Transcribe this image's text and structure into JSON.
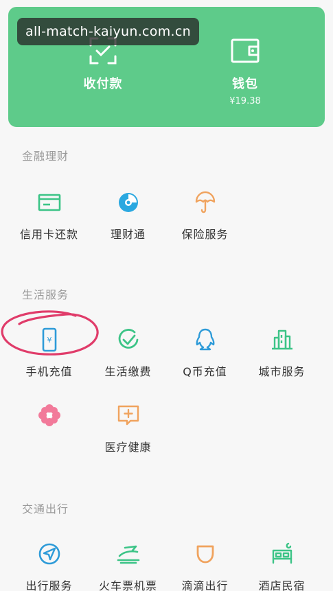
{
  "watermark": {
    "text": "all-match-kaiyun.com.cn"
  },
  "wallet_card": {
    "pay": {
      "label": "收付款",
      "icon": "qr-scan-icon"
    },
    "wallet": {
      "label": "钱包",
      "balance": "¥19.38",
      "icon": "wallet-icon"
    }
  },
  "sections": {
    "finance": {
      "title": "金融理财",
      "items": [
        {
          "label": "信用卡还款",
          "icon": "credit-card-icon",
          "color": "#3cc487"
        },
        {
          "label": "理财通",
          "icon": "wealth-icon",
          "color": "#2aa8e0"
        },
        {
          "label": "保险服务",
          "icon": "umbrella-icon",
          "color": "#f0a35e"
        }
      ]
    },
    "life": {
      "title": "生活服务",
      "items": [
        {
          "label": "手机充值",
          "icon": "phone-yuan-icon",
          "color": "#2e9bd8"
        },
        {
          "label": "生活缴费",
          "icon": "checkmark-circle-icon",
          "color": "#3cc487"
        },
        {
          "label": "Q币充值",
          "icon": "qq-penguin-icon",
          "color": "#2e9bd8"
        },
        {
          "label": "城市服务",
          "icon": "city-buildings-icon",
          "color": "#3cc487"
        },
        {
          "label": "",
          "icon": "flower-icon",
          "color": "#f27a9a"
        },
        {
          "label": "医疗健康",
          "icon": "medical-chat-icon",
          "color": "#f0a35e"
        }
      ]
    },
    "transport": {
      "title": "交通出行",
      "items": [
        {
          "label": "出行服务",
          "icon": "navigation-arrow-icon",
          "color": "#2e9bd8"
        },
        {
          "label": "火车票机票",
          "icon": "train-plane-icon",
          "color": "#3cc487"
        },
        {
          "label": "滴滴出行",
          "icon": "didi-icon",
          "color": "#f0a35e"
        },
        {
          "label": "酒店民宿",
          "icon": "hotel-bed-icon",
          "color": "#3cc487"
        }
      ]
    }
  },
  "annotation": {
    "color": "#e03c6a"
  }
}
